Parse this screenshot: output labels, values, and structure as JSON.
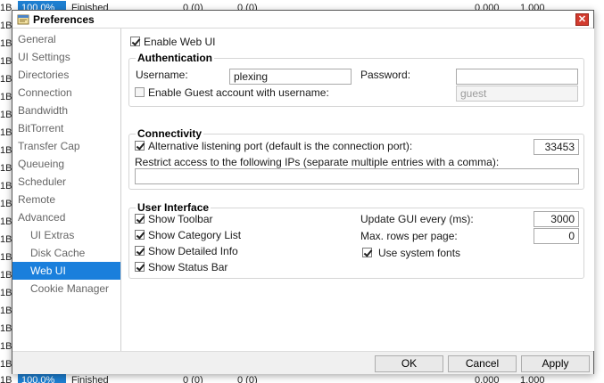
{
  "background": {
    "rows": [
      {
        "size": "1B",
        "percent": "100.0%",
        "status": "Finished",
        "a": "0 (0)",
        "b": "0 (0)",
        "ratio": "0.000",
        "avail": "1.000"
      },
      {
        "size": "1B",
        "percent": "100.0%",
        "status": "Finished",
        "a": "0 (0)",
        "b": "0 (0)",
        "ratio": "0.000",
        "avail": "1.000"
      }
    ],
    "side_labels": [
      "1B",
      "1B",
      "1B",
      "1B",
      "1B",
      "1B",
      "1B",
      "1B",
      "1B",
      "1B",
      "1B",
      "1B",
      "1B",
      "1B",
      "1B",
      "1B",
      "1B",
      "1B",
      "1B",
      "1B"
    ]
  },
  "dialog": {
    "title": "Preferences",
    "close_glyph": "✕",
    "sidebar": [
      "General",
      "UI Settings",
      "Directories",
      "Connection",
      "Bandwidth",
      "BitTorrent",
      "Transfer Cap",
      "Queueing",
      "Scheduler",
      "Remote",
      "Advanced",
      "UI Extras",
      "Disk Cache",
      "Web UI",
      "Cookie Manager"
    ],
    "enable_web_ui": {
      "label": "Enable Web UI",
      "checked": true
    },
    "authentication": {
      "title": "Authentication",
      "username_label": "Username:",
      "username_value": "plexing",
      "password_label": "Password:",
      "password_value": "",
      "guest_label": "Enable Guest account with username:",
      "guest_checked": false,
      "guest_value": "guest"
    },
    "connectivity": {
      "title": "Connectivity",
      "alt_port_label": "Alternative listening port (default is the connection port):",
      "alt_port_checked": true,
      "alt_port_value": "33453",
      "restrict_label": "Restrict access to the following IPs (separate multiple entries with a comma):",
      "restrict_value": ""
    },
    "user_interface": {
      "title": "User Interface",
      "show_toolbar": "Show Toolbar",
      "show_category_list": "Show Category List",
      "show_detailed_info": "Show Detailed Info",
      "show_status_bar": "Show Status Bar",
      "update_gui_label": "Update GUI every (ms):",
      "update_gui_value": "3000",
      "max_rows_label": "Max. rows per page:",
      "max_rows_value": "0",
      "system_fonts_label": "Use system fonts"
    },
    "buttons": {
      "ok": "OK",
      "cancel": "Cancel",
      "apply": "Apply"
    },
    "colors": {
      "accent": "#1a7fdc",
      "close": "#d23b2e"
    }
  }
}
